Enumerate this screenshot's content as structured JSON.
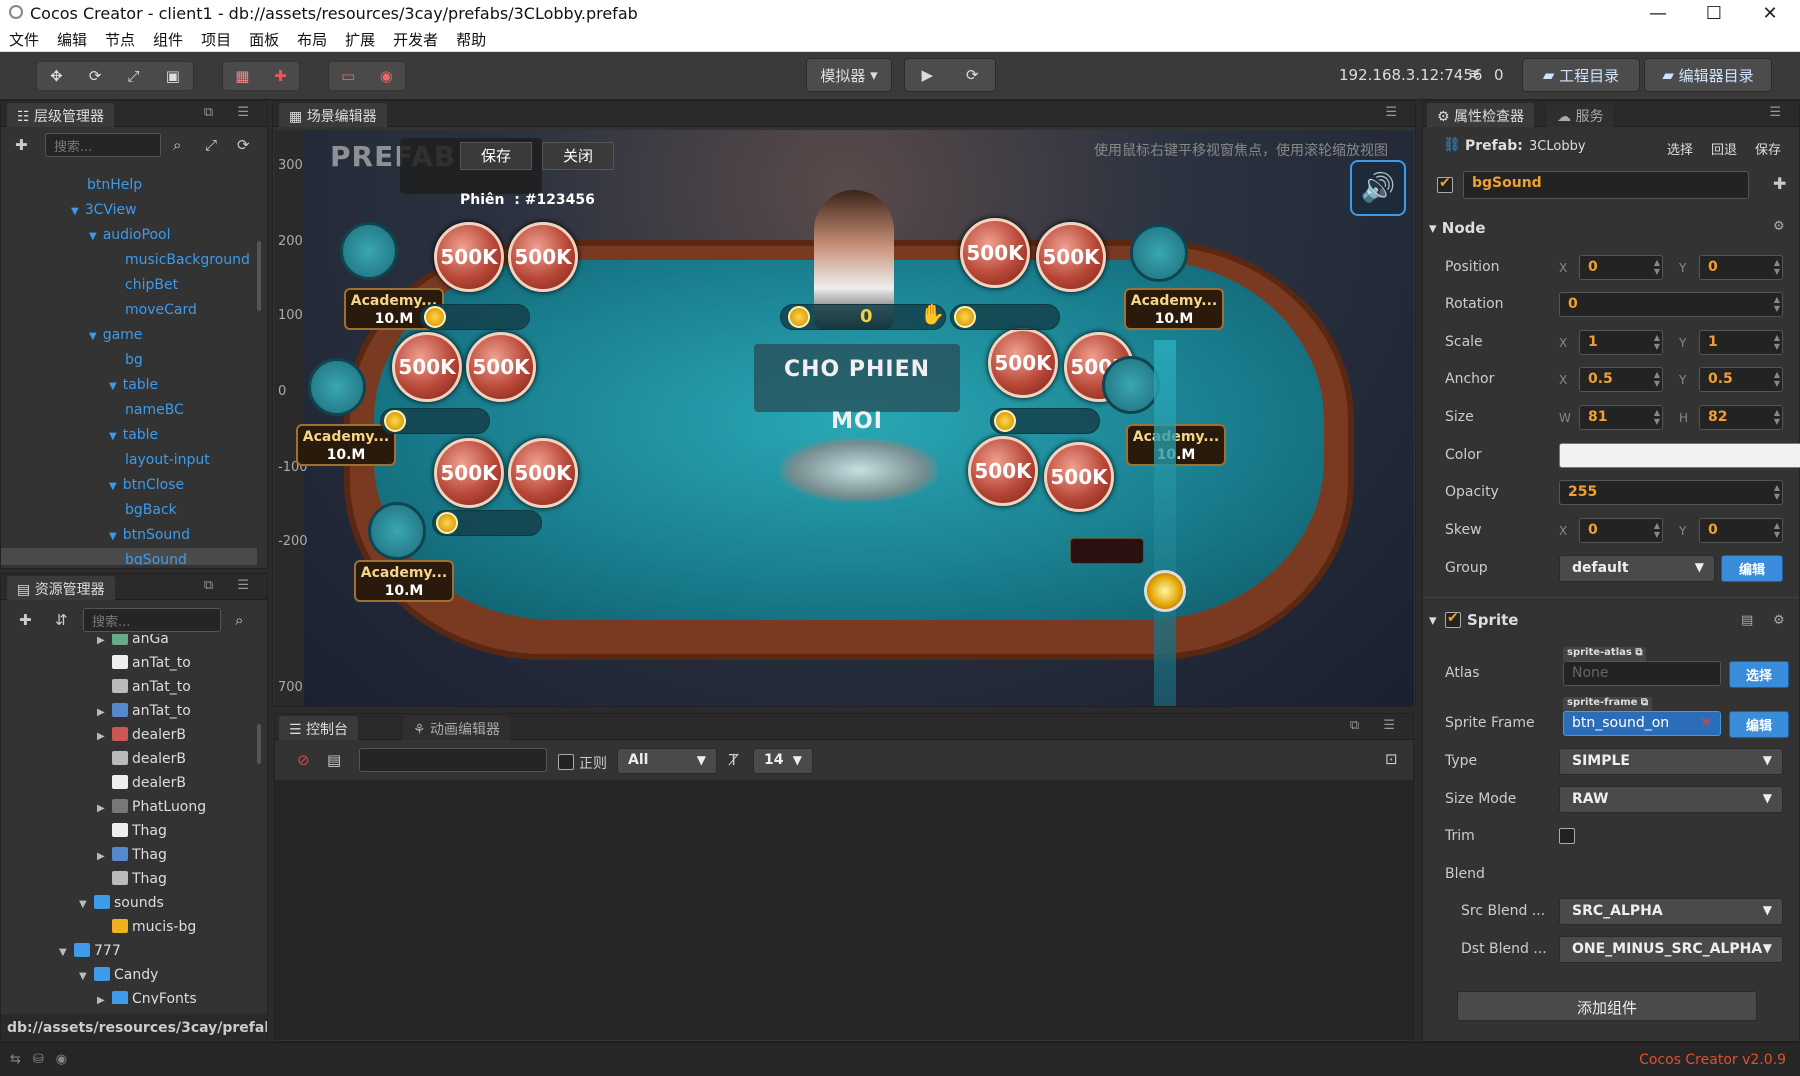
{
  "window": {
    "title": "Cocos Creator - client1 - db://assets/resources/3cay/prefabs/3CLobby.prefab",
    "minimize": "—",
    "maximize": "☐",
    "close": "✕"
  },
  "menu": [
    "文件",
    "编辑",
    "节点",
    "组件",
    "项目",
    "面板",
    "布局",
    "扩展",
    "开发者",
    "帮助"
  ],
  "toolbar": {
    "simulator_label": "模拟器",
    "ip": "192.168.3.12:7456",
    "connections": "0",
    "project_dir": "工程目录",
    "editor_dir": "编辑器目录"
  },
  "hierarchy": {
    "tab": "层级管理器",
    "search_placeholder": "搜索...",
    "nodes": [
      {
        "label": "btnHelp",
        "depth": 0,
        "arrow": ""
      },
      {
        "label": "3CView",
        "depth": 0,
        "arrow": "▼"
      },
      {
        "label": "audioPool",
        "depth": 1,
        "arrow": "▼"
      },
      {
        "label": "musicBackground",
        "depth": 2,
        "arrow": ""
      },
      {
        "label": "chipBet",
        "depth": 2,
        "arrow": ""
      },
      {
        "label": "moveCard",
        "depth": 2,
        "arrow": ""
      },
      {
        "label": "game",
        "depth": 1,
        "arrow": "▼"
      },
      {
        "label": "bg",
        "depth": 2,
        "arrow": ""
      },
      {
        "label": "table",
        "depth": 2,
        "arrow": "▼"
      },
      {
        "label": "nameBC",
        "depth": 3,
        "arrow": ""
      },
      {
        "label": "table",
        "depth": 2,
        "arrow": "▼"
      },
      {
        "label": "layout-input",
        "depth": 3,
        "arrow": ""
      },
      {
        "label": "btnClose",
        "depth": 2,
        "arrow": "▼"
      },
      {
        "label": "bgBack",
        "depth": 3,
        "arrow": ""
      },
      {
        "label": "btnSound",
        "depth": 2,
        "arrow": "▼"
      },
      {
        "label": "bgSound",
        "depth": 3,
        "arrow": "",
        "selected": true
      }
    ]
  },
  "assets": {
    "tab": "资源管理器",
    "search_placeholder": "搜索...",
    "path": "db://assets/resources/3cay/prefab...",
    "items": [
      {
        "label": "anGa",
        "depth": 2,
        "arrow": "▶",
        "icon": "#6a8"
      },
      {
        "label": "anTat_to",
        "depth": 2,
        "arrow": "",
        "icon": "#eee"
      },
      {
        "label": "anTat_to",
        "depth": 2,
        "arrow": "",
        "icon": "#bbb"
      },
      {
        "label": "anTat_to",
        "depth": 2,
        "arrow": "▶",
        "icon": "#58c"
      },
      {
        "label": "dealerB",
        "depth": 2,
        "arrow": "▶",
        "icon": "#c55"
      },
      {
        "label": "dealerB",
        "depth": 2,
        "arrow": "",
        "icon": "#bbb"
      },
      {
        "label": "dealerB",
        "depth": 2,
        "arrow": "",
        "icon": "#eee"
      },
      {
        "label": "PhatLuong",
        "depth": 2,
        "arrow": "▶",
        "icon": "#777"
      },
      {
        "label": "Thag",
        "depth": 2,
        "arrow": "",
        "icon": "#eee"
      },
      {
        "label": "Thag",
        "depth": 2,
        "arrow": "▶",
        "icon": "#58c"
      },
      {
        "label": "Thag",
        "depth": 2,
        "arrow": "",
        "icon": "#bbb"
      },
      {
        "label": "sounds",
        "depth": 1,
        "arrow": "▼",
        "icon": "#3d9be9"
      },
      {
        "label": "mucis-bg",
        "depth": 2,
        "arrow": "",
        "icon": "#f0b020"
      },
      {
        "label": "777",
        "depth": 0,
        "arrow": "▼",
        "icon": "#3d9be9"
      },
      {
        "label": "Candy",
        "depth": 1,
        "arrow": "▼",
        "icon": "#3d9be9"
      },
      {
        "label": "CnyFonts",
        "depth": 2,
        "arrow": "▶",
        "icon": "#3d9be9"
      }
    ]
  },
  "scene": {
    "tab": "场景编辑器",
    "hint": "使用鼠标右键平移视窗焦点，使用滚轮缩放视图",
    "save": "保存",
    "close": "关闭",
    "session": "Phiên  : #123456",
    "watermark": "PREFAB",
    "ruler": [
      "300",
      "200",
      "100",
      "0",
      "-100",
      "-200",
      "700"
    ],
    "pot_value": "0",
    "status_text": "CHO PHIEN MOI",
    "chip_label": "500K",
    "seat_chip": "500K",
    "player_name": "Academy...",
    "player_money": "10.M"
  },
  "console": {
    "tab": "控制台",
    "anim_tab": "动画编辑器",
    "regex_label": "正则",
    "filter": "All",
    "font_size": "14"
  },
  "inspector": {
    "tab": "属性检查器",
    "service_tab": "服务",
    "prefab_label": "Prefab:",
    "prefab_name": "3CLobby",
    "select": "选择",
    "revert": "回退",
    "save": "保存",
    "node_name": "bgSound",
    "node_section": "Node",
    "position": {
      "label": "Position",
      "x": "0",
      "y": "0"
    },
    "rotation": {
      "label": "Rotation",
      "value": "0"
    },
    "scale": {
      "label": "Scale",
      "x": "1",
      "y": "1"
    },
    "anchor": {
      "label": "Anchor",
      "x": "0.5",
      "y": "0.5"
    },
    "size": {
      "label": "Size",
      "w": "81",
      "h": "82"
    },
    "color": {
      "label": "Color",
      "value": "#f2f2f2"
    },
    "opacity": {
      "label": "Opacity",
      "value": "255"
    },
    "skew": {
      "label": "Skew",
      "x": "0",
      "y": "0"
    },
    "group": {
      "label": "Group",
      "value": "default",
      "edit": "编辑"
    },
    "sprite_section": "Sprite",
    "atlas": {
      "label": "Atlas",
      "tag": "sprite-atlas",
      "value": "None",
      "button": "选择"
    },
    "sprite_frame": {
      "label": "Sprite Frame",
      "tag": "sprite-frame",
      "value": "btn_sound_on",
      "button": "编辑"
    },
    "type": {
      "label": "Type",
      "value": "SIMPLE"
    },
    "size_mode": {
      "label": "Size Mode",
      "value": "RAW"
    },
    "trim": {
      "label": "Trim"
    },
    "blend": {
      "label": "Blend"
    },
    "src_blend": {
      "label": "Src Blend ...",
      "value": "SRC_ALPHA"
    },
    "dst_blend": {
      "label": "Dst Blend ...",
      "value": "ONE_MINUS_SRC_ALPHA"
    },
    "add_component": "添加组件"
  },
  "statusbar": {
    "version": "Cocos Creator v2.0.9"
  },
  "colors": {
    "accent": "#3d9be9",
    "value_orange": "#f0a030",
    "version_red": "#e0502a"
  }
}
